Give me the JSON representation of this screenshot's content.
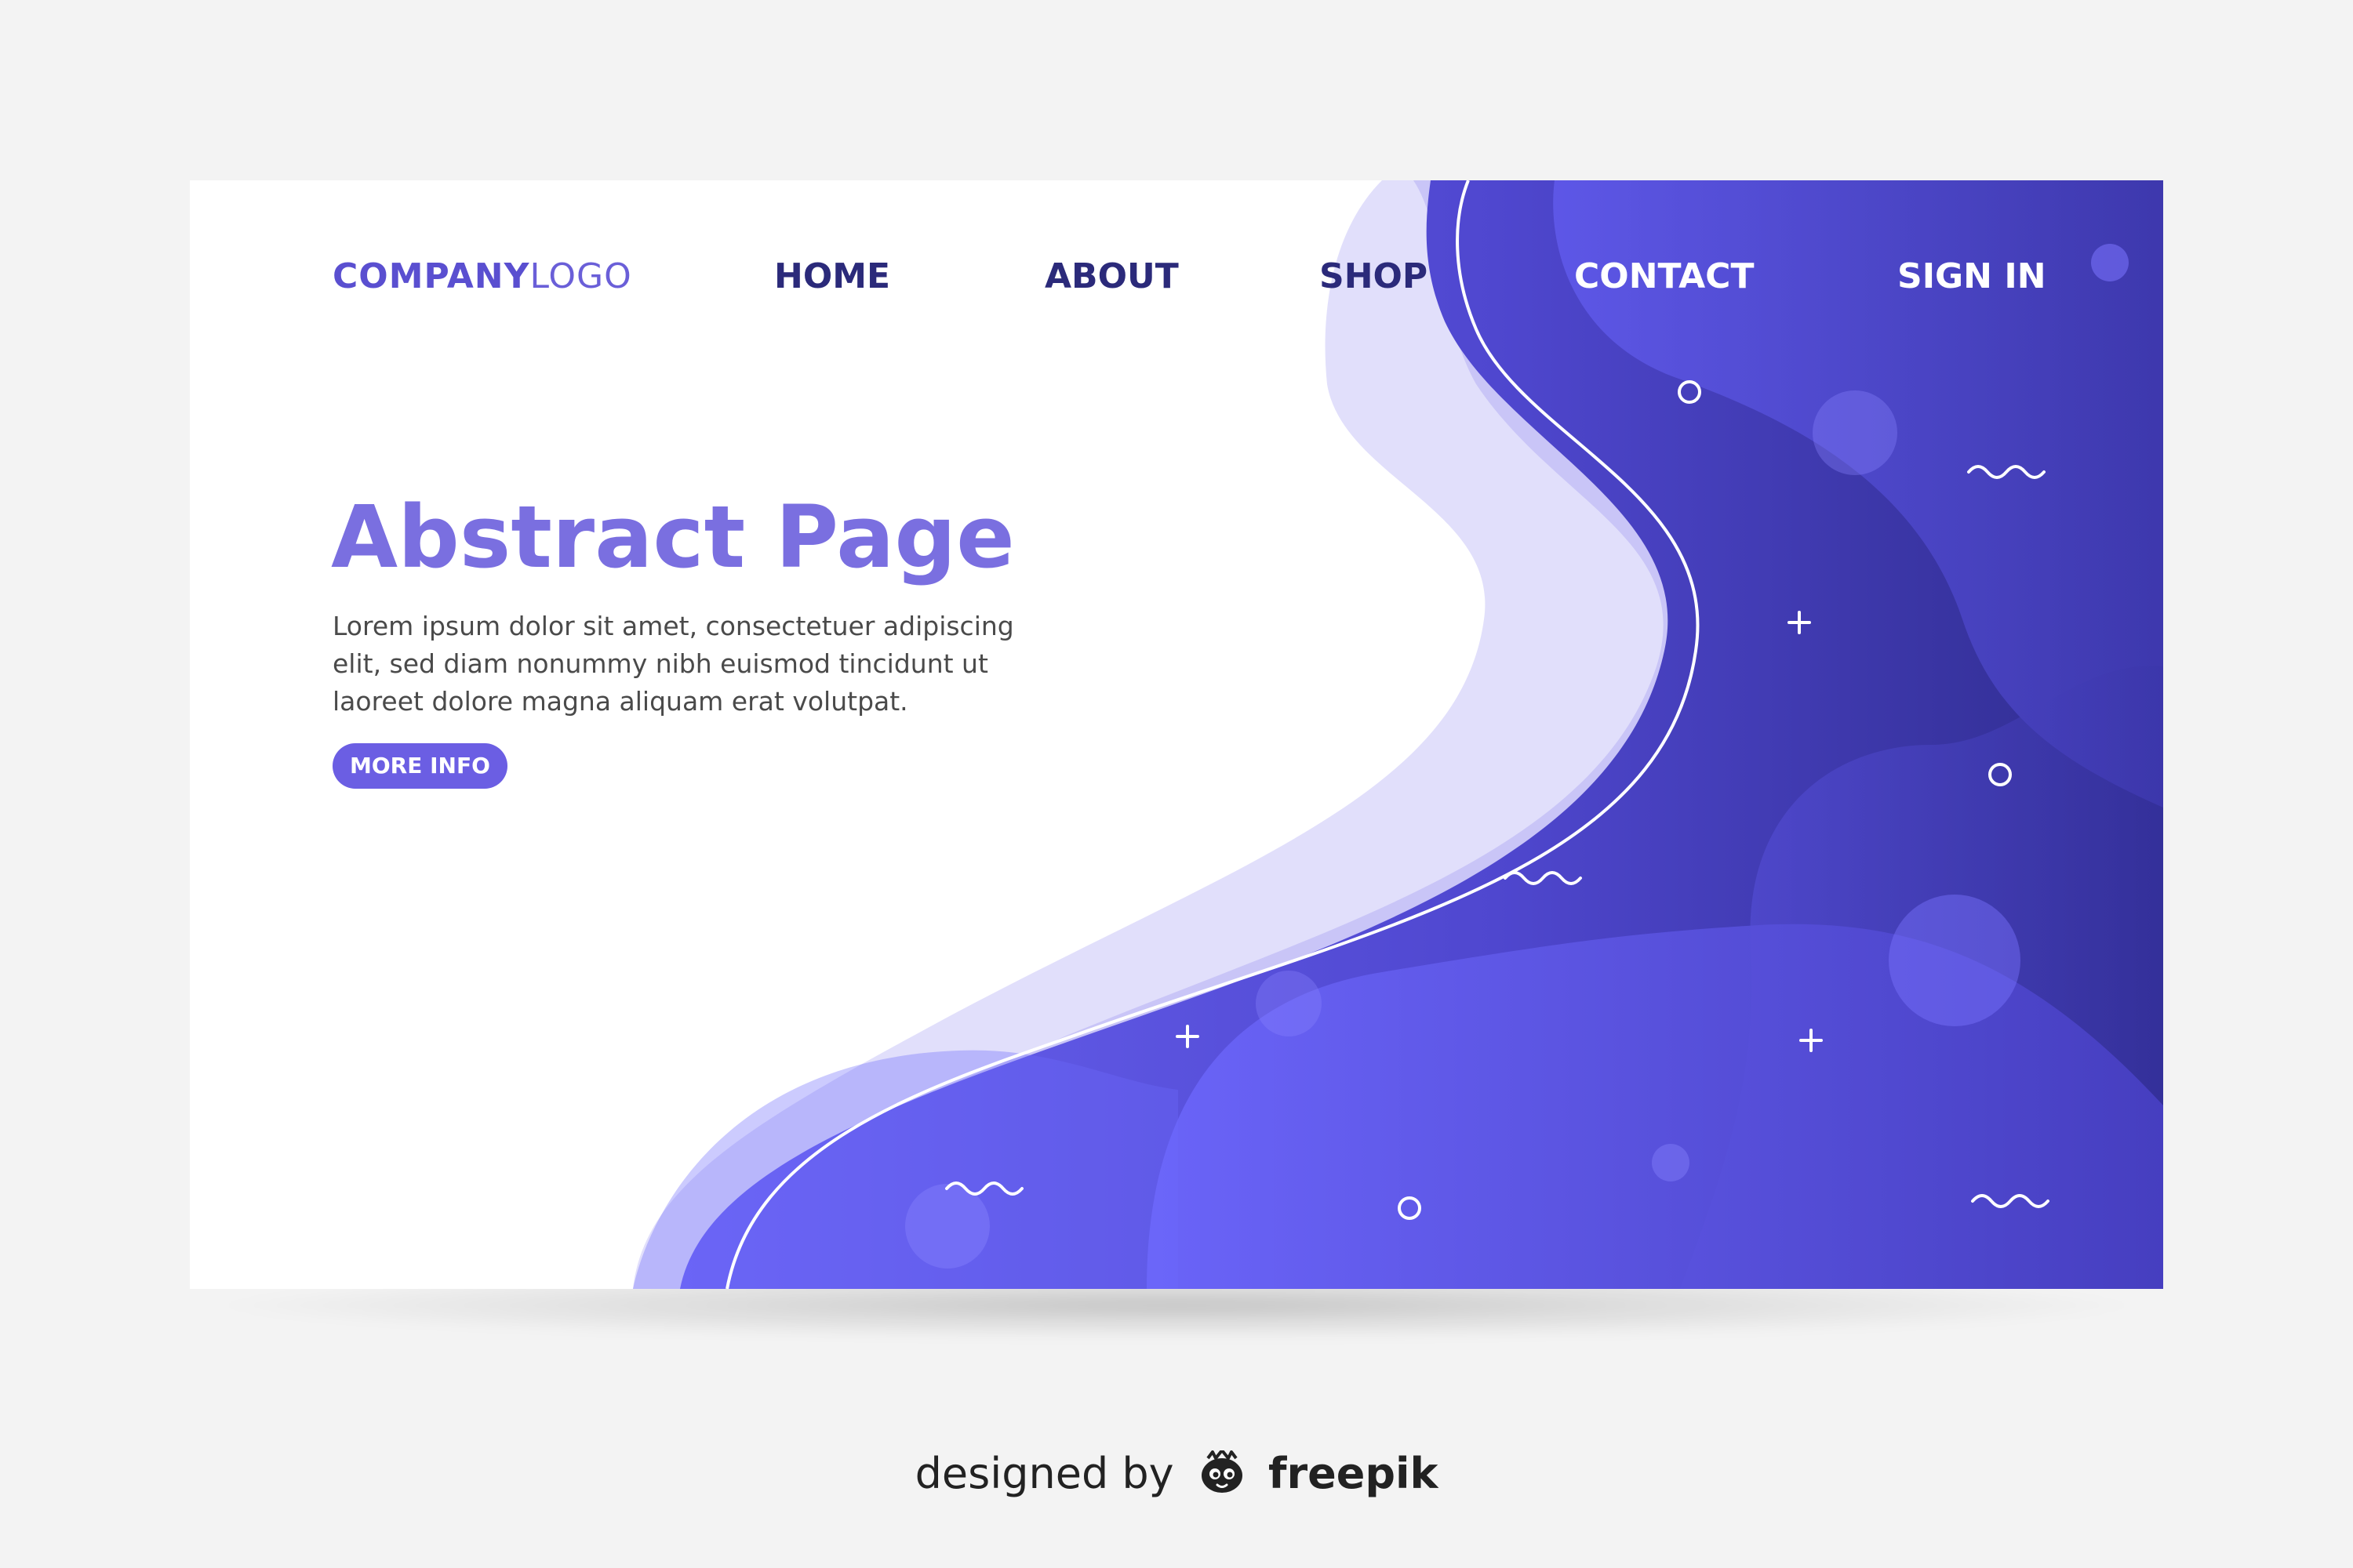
{
  "nav": {
    "logo_strong": "COMPANY",
    "logo_light": "LOGO",
    "items": [
      {
        "label": "HOME"
      },
      {
        "label": "ABOUT"
      },
      {
        "label": "SHOP"
      },
      {
        "label": "CONTACT"
      },
      {
        "label": "SIGN IN"
      }
    ]
  },
  "hero": {
    "title": "Abstract Page",
    "body": "Lorem ipsum dolor sit amet, consectetuer adipiscing elit, sed diam nonummy nibh euismod tincidunt ut laoreet dolore magna aliquam erat volutpat.",
    "button_label": "MORE INFO"
  },
  "credit": {
    "designed_by": "designed by",
    "brand": "freepik",
    "brand_icon": "freepik-logo-icon"
  },
  "colors": {
    "background": "#f3f3f3",
    "card": "#ffffff",
    "accent": "#6b5ee3",
    "title": "#7a6fe0",
    "nav_dark": "#2b2a7a",
    "wave_light": "#e1dffb",
    "wave_mid": "#c9c5f7",
    "wave_dark_start": "#6a63f3",
    "wave_dark_end": "#2e2b8c"
  }
}
